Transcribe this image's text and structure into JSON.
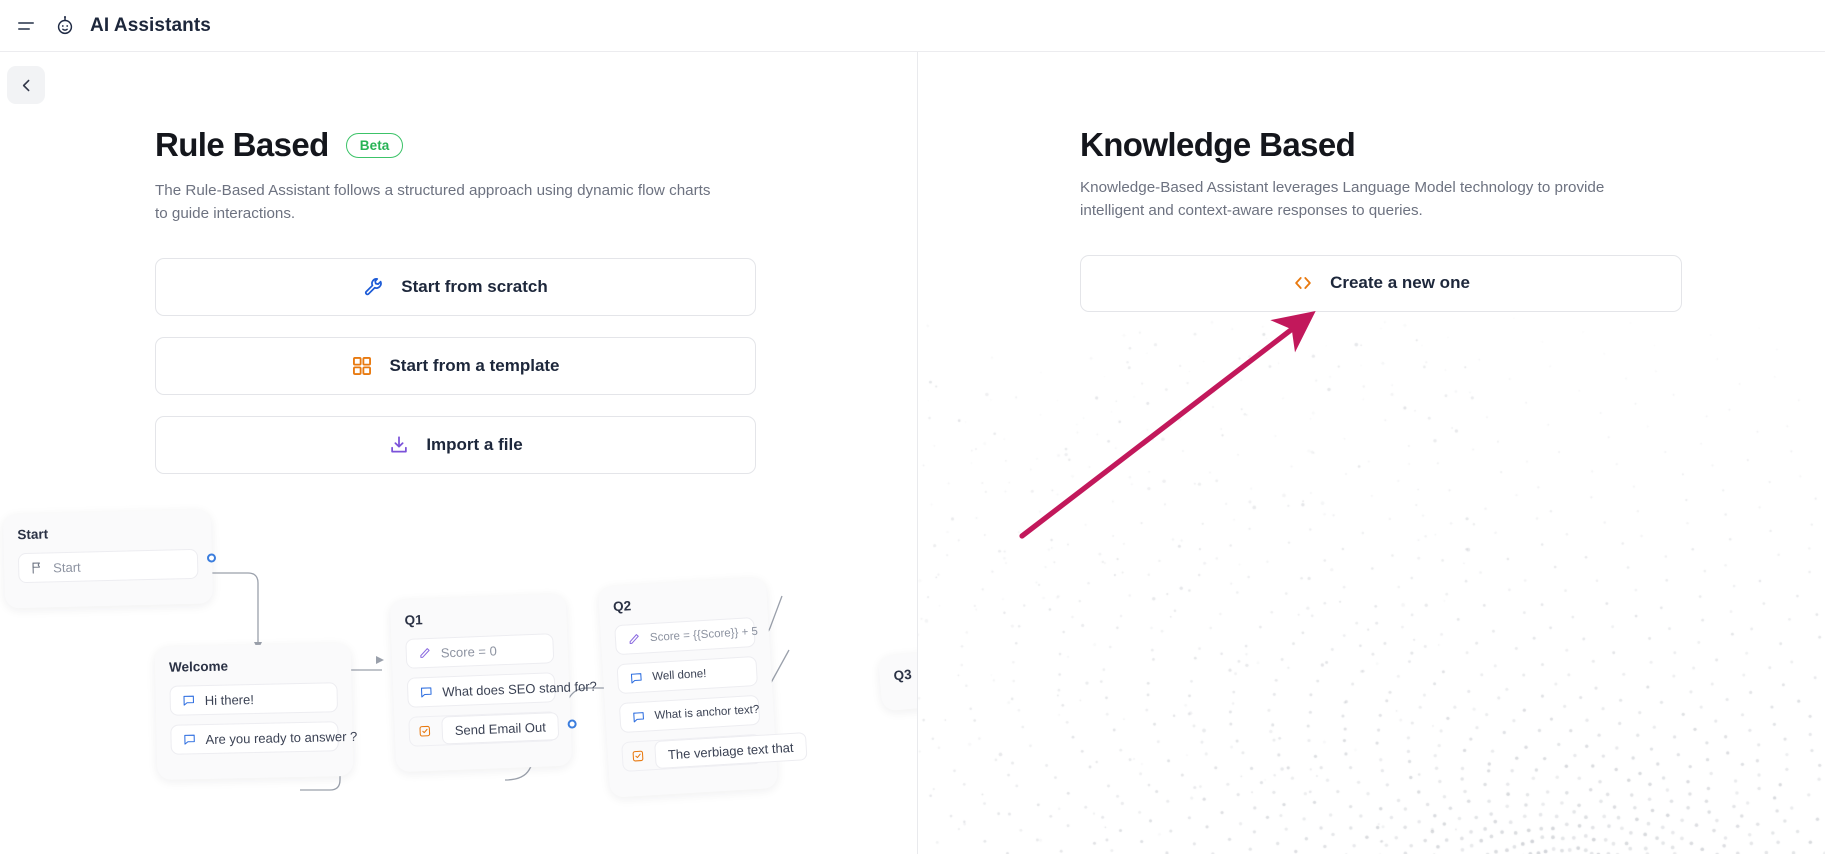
{
  "header": {
    "menu_icon": "hamburger-icon",
    "logo_icon": "robot-icon",
    "title": "AI Assistants"
  },
  "back_button": {
    "icon": "chevron-left-icon",
    "label": ""
  },
  "left_panel": {
    "title": "Rule Based",
    "badge": "Beta",
    "badge_color": "#27b355",
    "description": "The Rule-Based Assistant follows a structured approach using dynamic flow charts to guide interactions.",
    "buttons": [
      {
        "label": "Start from scratch",
        "icon": "wrench-icon",
        "icon_color": "#1d5bd6"
      },
      {
        "label": "Start from a template",
        "icon": "grid-icon",
        "icon_color": "#e8790f"
      },
      {
        "label": "Import a file",
        "icon": "download-icon",
        "icon_color": "#7b52d9"
      }
    ]
  },
  "right_panel": {
    "title": "Knowledge Based",
    "description": "Knowledge-Based Assistant leverages Language Model technology to provide intelligent and context-aware responses to queries.",
    "buttons": [
      {
        "label": "Create a new one",
        "icon": "code-brackets-icon",
        "icon_color": "#e8790f"
      }
    ]
  },
  "annotation": {
    "type": "arrow",
    "color": "#c2185b",
    "points_to": "Create a new one"
  },
  "flowchart": {
    "nodes": [
      {
        "title": "Start",
        "rows": [
          {
            "text": "Start",
            "icon": "flag-icon",
            "icon_color": "#6b7280",
            "style": "muted"
          }
        ]
      },
      {
        "title": "Welcome",
        "rows": [
          {
            "text": "Hi there!",
            "icon": "chat-icon",
            "icon_color": "#2f6fe0",
            "style": "normal"
          },
          {
            "text": "Are you ready to answer ?",
            "icon": "chat-icon",
            "icon_color": "#2f6fe0",
            "style": "normal"
          }
        ]
      },
      {
        "title": "Q1",
        "rows": [
          {
            "text": "Score = 0",
            "icon": "pencil-icon",
            "icon_color": "#8b6be0",
            "style": "muted"
          },
          {
            "text": "What does SEO stand for?",
            "icon": "chat-icon",
            "icon_color": "#2f6fe0",
            "style": "normal"
          },
          {
            "text": "Send Email Out",
            "icon": "task-icon",
            "icon_color": "#e8790f",
            "style": "action"
          }
        ]
      },
      {
        "title": "Q2",
        "rows": [
          {
            "text": "Score = {{Score}} + 5",
            "icon": "pencil-icon",
            "icon_color": "#8b6be0",
            "style": "muted"
          },
          {
            "text": "Well done!",
            "icon": "chat-icon",
            "icon_color": "#2f6fe0",
            "style": "normal"
          },
          {
            "text": "What is anchor text?",
            "icon": "chat-icon",
            "icon_color": "#2f6fe0",
            "style": "normal"
          },
          {
            "text": "The verbiage text that",
            "icon": "task-icon",
            "icon_color": "#e8790f",
            "style": "action"
          }
        ]
      },
      {
        "title": "Q3",
        "rows": []
      }
    ]
  }
}
